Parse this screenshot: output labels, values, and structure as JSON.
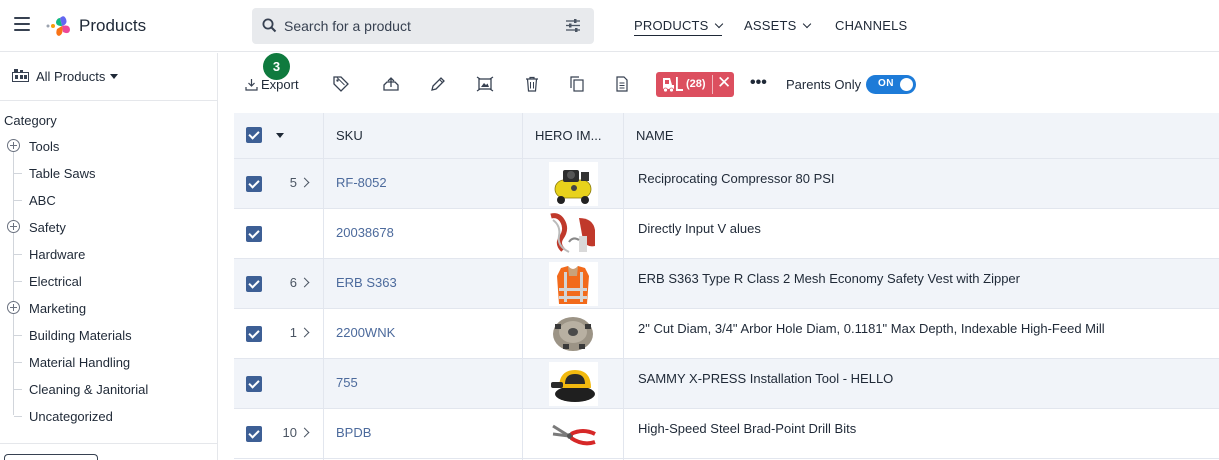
{
  "header": {
    "app_title": "Products",
    "search_placeholder": "Search for a product",
    "nav": [
      {
        "label": "PRODUCTS",
        "active": true,
        "has_dropdown": true
      },
      {
        "label": "ASSETS",
        "active": false,
        "has_dropdown": true
      },
      {
        "label": "CHANNELS",
        "active": false,
        "has_dropdown": false
      }
    ]
  },
  "sidebar": {
    "selector_label": "All Products",
    "category_title": "Category",
    "categories": [
      {
        "label": "Tools",
        "expandable": true
      },
      {
        "label": "Table Saws",
        "expandable": false
      },
      {
        "label": "ABC",
        "expandable": false
      },
      {
        "label": "Safety",
        "expandable": true
      },
      {
        "label": "Hardware",
        "expandable": false
      },
      {
        "label": "Electrical",
        "expandable": false
      },
      {
        "label": "Marketing",
        "expandable": true
      },
      {
        "label": "Building Materials",
        "expandable": false
      },
      {
        "label": "Material Handling",
        "expandable": false
      },
      {
        "label": "Cleaning & Janitorial",
        "expandable": false
      },
      {
        "label": "Uncategorized",
        "expandable": false
      }
    ]
  },
  "toolbar": {
    "notification_badge": "3",
    "export_label": "Export",
    "icons": [
      "tag-icon",
      "upload-icon",
      "edit-icon",
      "image-edit-icon",
      "delete-icon",
      "copy-icon",
      "document-icon"
    ],
    "filter_chip": {
      "count": "(28)",
      "close": "✕",
      "color": "#dc4f5f"
    },
    "more_label": "•••",
    "parents_only_label": "Parents Only",
    "toggle_label": "ON",
    "toggle_on": true
  },
  "table": {
    "columns": {
      "sku": "SKU",
      "hero_image": "HERO IM...",
      "name": "NAME"
    },
    "rows": [
      {
        "count": "5",
        "sku": "RF-8052",
        "image": "compressor-image",
        "name": "Reciprocating Compressor 80 PSI",
        "checked": true
      },
      {
        "count": "",
        "sku": "20038678",
        "image": "hose-tool-image",
        "name": "Directly Input V alues",
        "checked": true
      },
      {
        "count": "6",
        "sku": "ERB S363",
        "image": "safety-vest-image",
        "name": "ERB S363 Type R Class 2 Mesh Economy Safety Vest with Zipper",
        "checked": true
      },
      {
        "count": "1",
        "sku": "2200WNK",
        "image": "milling-cutter-image",
        "name": "2\" Cut Diam, 3/4\" Arbor Hole Diam, 0.1181\" Max Depth, Indexable High-Feed Mill",
        "checked": true
      },
      {
        "count": "",
        "sku": "755",
        "image": "orbital-sander-image",
        "name": "SAMMY X-PRESS Installation Tool - HELLO",
        "checked": true
      },
      {
        "count": "10",
        "sku": "BPDB",
        "image": "pliers-image",
        "name": "High-Speed Steel Brad-Point Drill Bits",
        "checked": true
      }
    ]
  },
  "colors": {
    "accent_blue": "#1d7bd8",
    "checkbox": "#3d5f95",
    "sku_link": "#4c6a9c",
    "badge_green": "#0f7a3e",
    "row_alt": "#f1f4f9"
  }
}
